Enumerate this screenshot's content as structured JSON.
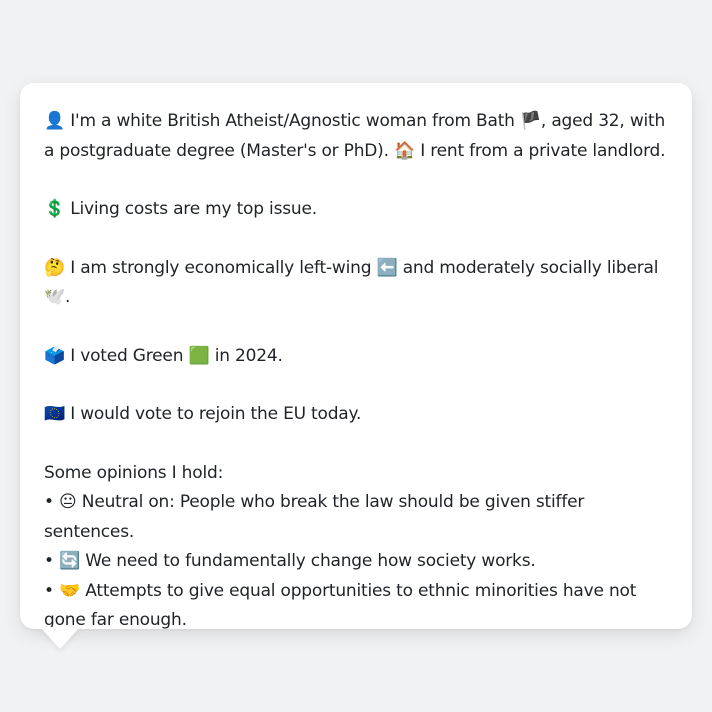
{
  "profile": {
    "line1_emoji": "👤",
    "line1_text": "I'm a white British Atheist/Agnostic woman from Bath",
    "flag_emoji": "🏴",
    "line1_rest": ", aged 32, with a postgraduate degree (Master's or PhD).",
    "home_emoji": "🏠",
    "line1_end": "I rent from a private landlord.",
    "issue_emoji": "💲",
    "issue_text": "Living costs are my top issue.",
    "think_emoji": "🤔",
    "politics_text_a": "I am strongly economically left-wing",
    "left_emoji": "⬅️",
    "politics_text_b": "and moderately socially liberal",
    "dove_emoji": "🕊️",
    "politics_end": ".",
    "ballot_emoji": "🗳️",
    "vote_text_a": "I voted Green",
    "green_emoji": "🟩",
    "vote_text_b": "in 2024.",
    "eu_emoji": "🇪🇺",
    "eu_text": "I would vote to rejoin the EU today.",
    "opinions_heading": "Some opinions I hold:",
    "opinions": [
      {
        "bullet": "•",
        "emoji": "😐",
        "text": "Neutral on: People who break the law should be given stiffer sentences."
      },
      {
        "bullet": "•",
        "emoji": "🔄",
        "text": "We need to fundamentally change how society works."
      },
      {
        "bullet": "•",
        "emoji": "🤝",
        "text": "Attempts to give equal opportunities to ethnic minorities have not gone far enough."
      }
    ]
  }
}
